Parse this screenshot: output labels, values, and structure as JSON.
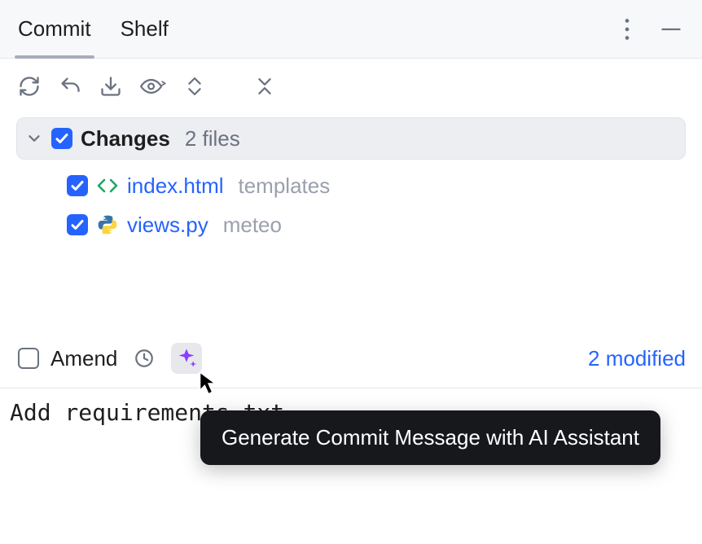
{
  "tabs": {
    "commit": "Commit",
    "shelf": "Shelf"
  },
  "changes": {
    "title": "Changes",
    "count": "2 files",
    "files": [
      {
        "name": "index.html",
        "dir": "templates"
      },
      {
        "name": "views.py",
        "dir": "meteo"
      }
    ]
  },
  "commit_bar": {
    "amend_label": "Amend",
    "status": "2 modified"
  },
  "commit_message": "Add requirements.txt",
  "tooltip": "Generate Commit Message with AI Assistant"
}
